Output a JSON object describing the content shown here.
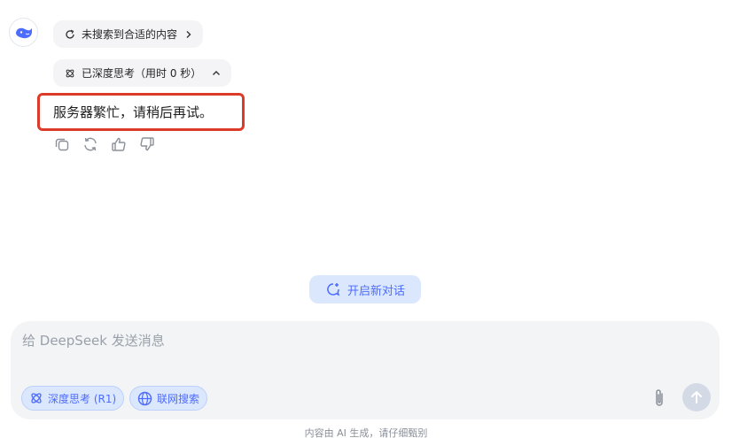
{
  "message": {
    "search_status": "未搜索到合适的内容",
    "thinking_status": "已深度思考（用时 0 秒）",
    "answer": "服务器繁忙，请稍后再试。"
  },
  "new_chat": {
    "label": "开启新对话"
  },
  "composer": {
    "placeholder": "给 DeepSeek 发送消息",
    "value": "",
    "deep_think_label": "深度思考 (R1)",
    "web_search_label": "联网搜索"
  },
  "footer": {
    "note": "内容由 AI 生成，请仔细甄别"
  },
  "colors": {
    "accent": "#4d6bfe",
    "accent_bg": "#dbe7fd",
    "highlight_border": "#dd3b2a",
    "chip_bg": "#f4f4f6",
    "composer_bg": "#f3f4f6"
  },
  "icons": {
    "avatar": "deepseek-whale-icon",
    "search": "refresh-search-icon",
    "think": "atom-icon",
    "copy": "copy-icon",
    "regenerate": "regenerate-icon",
    "like": "thumbs-up-icon",
    "dislike": "thumbs-down-icon",
    "new_chat": "new-chat-icon",
    "globe": "globe-icon",
    "attach": "paperclip-icon",
    "send": "arrow-up-icon"
  }
}
